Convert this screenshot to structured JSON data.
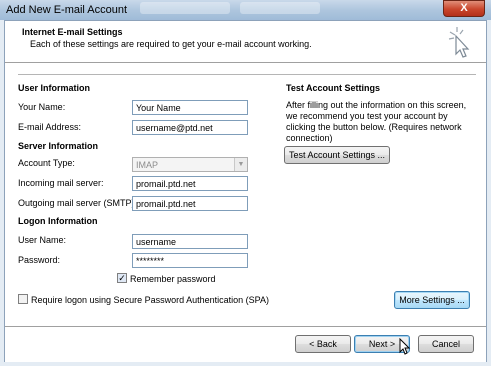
{
  "window": {
    "title": "Add New E-mail Account",
    "close_label": "X"
  },
  "header": {
    "title": "Internet E-mail Settings",
    "subtitle": "Each of these settings are required to get your e-mail account working."
  },
  "user_info": {
    "section_title": "User Information",
    "name_label": "Your Name:",
    "name_value": "Your Name",
    "email_label": "E-mail Address:",
    "email_value": "username@ptd.net"
  },
  "server_info": {
    "section_title": "Server Information",
    "account_type_label": "Account Type:",
    "account_type_value": "IMAP",
    "incoming_label": "Incoming mail server:",
    "incoming_value": "promail.ptd.net",
    "outgoing_label": "Outgoing mail server (SMTP):",
    "outgoing_value": "promail.ptd.net"
  },
  "logon_info": {
    "section_title": "Logon Information",
    "username_label": "User Name:",
    "username_value": "username",
    "password_label": "Password:",
    "password_value": "********",
    "remember_label": "Remember password",
    "remember_checked": true,
    "spa_label": "Require logon using Secure Password Authentication (SPA)",
    "spa_checked": false
  },
  "test_settings": {
    "section_title": "Test Account Settings",
    "description": "After filling out the information on this screen, we recommend you test your account by clicking the button below. (Requires network connection)",
    "test_button": "Test Account Settings ..."
  },
  "more_settings_button": "More Settings ...",
  "footer": {
    "back_button": "< Back",
    "next_button": "Next >",
    "cancel_button": "Cancel"
  }
}
